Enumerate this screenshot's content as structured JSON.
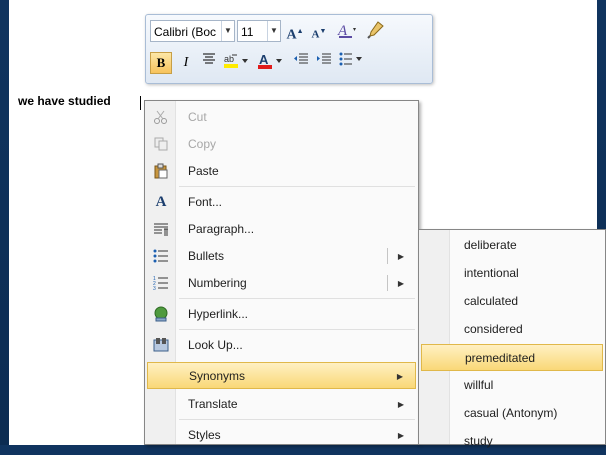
{
  "document": {
    "text": "we have studied"
  },
  "mini_toolbar": {
    "font_name": "Calibri (Boc",
    "font_size": "11",
    "grow_font_glyph": "A",
    "shrink_font_glyph": "A",
    "bold_glyph": "B",
    "italic_glyph": "I",
    "icons": [
      "font-dropdown-arrow-icon",
      "size-dropdown-arrow-icon",
      "grow-font-icon",
      "shrink-font-icon",
      "styles-icon",
      "format-painter-icon",
      "bold-icon",
      "italic-icon",
      "center-icon",
      "highlight-icon",
      "font-color-icon",
      "decrease-indent-icon",
      "increase-indent-icon",
      "bullets-icon"
    ]
  },
  "context_menu": {
    "items": [
      {
        "label": "Cut",
        "icon": "scissors-icon",
        "enabled": false
      },
      {
        "label": "Copy",
        "icon": "copy-icon",
        "enabled": false
      },
      {
        "label": "Paste",
        "icon": "paste-icon",
        "enabled": true
      },
      {
        "label": "Font...",
        "icon": "font-icon",
        "enabled": true
      },
      {
        "label": "Paragraph...",
        "icon": "paragraph-icon",
        "enabled": true
      },
      {
        "label": "Bullets",
        "icon": "bullets-icon",
        "enabled": true,
        "submenu": true
      },
      {
        "label": "Numbering",
        "icon": "numbering-icon",
        "enabled": true,
        "submenu": true
      },
      {
        "label": "Hyperlink...",
        "icon": "hyperlink-icon",
        "enabled": true
      },
      {
        "label": "Look Up...",
        "icon": "lookup-icon",
        "enabled": true
      },
      {
        "label": "Synonyms",
        "icon": "",
        "enabled": true,
        "submenu": true,
        "highlighted": true
      },
      {
        "label": "Translate",
        "icon": "",
        "enabled": true,
        "submenu": true
      },
      {
        "label": "Styles",
        "icon": "",
        "enabled": true,
        "submenu": true
      }
    ]
  },
  "synonyms_submenu": {
    "items": [
      {
        "label": "deliberate"
      },
      {
        "label": "intentional"
      },
      {
        "label": "calculated"
      },
      {
        "label": "considered"
      },
      {
        "label": "premeditated",
        "highlighted": true
      },
      {
        "label": "willful"
      },
      {
        "label": "casual (Antonym)"
      },
      {
        "label": "study"
      }
    ]
  },
  "colors": {
    "highlight": "#f9d877",
    "background": "#10345f",
    "icon_blue": "#3a5a85"
  }
}
